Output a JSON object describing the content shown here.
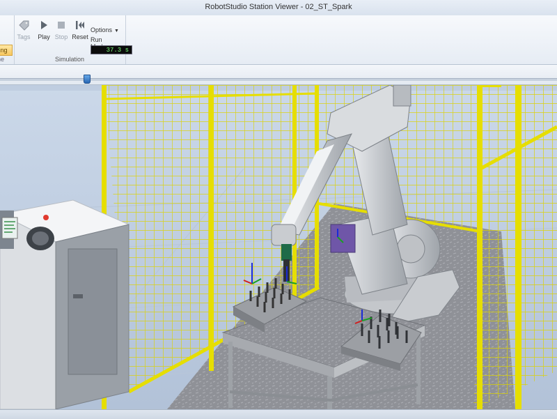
{
  "window": {
    "title": "RobotStudio Station Viewer - 02_ST_Spark"
  },
  "ribbon": {
    "left_group": {
      "active_button_label": "ting",
      "caption": "ne"
    },
    "simulation": {
      "caption": "Simulation",
      "buttons": [
        {
          "label": "Tags",
          "icon": "tag-icon",
          "enabled": false
        },
        {
          "label": "Play",
          "icon": "play-icon",
          "enabled": true
        },
        {
          "label": "Stop",
          "icon": "stop-icon",
          "enabled": false
        },
        {
          "label": "Reset",
          "icon": "reset-icon",
          "enabled": true
        }
      ],
      "options_label": "Options",
      "run_mode_label": "Run Mode",
      "time_readout": "37.3 s"
    }
  },
  "timeline": {
    "position_fraction": 0.15
  },
  "scene": {
    "objects": [
      "industrial-robot",
      "safety-fence",
      "robot-controller",
      "work-table",
      "pin-fixture"
    ],
    "colors": {
      "fence": "#e5de00",
      "robot": "#cfd2d6",
      "floor": "#8e9096",
      "sky": "#c6d4e6"
    }
  }
}
